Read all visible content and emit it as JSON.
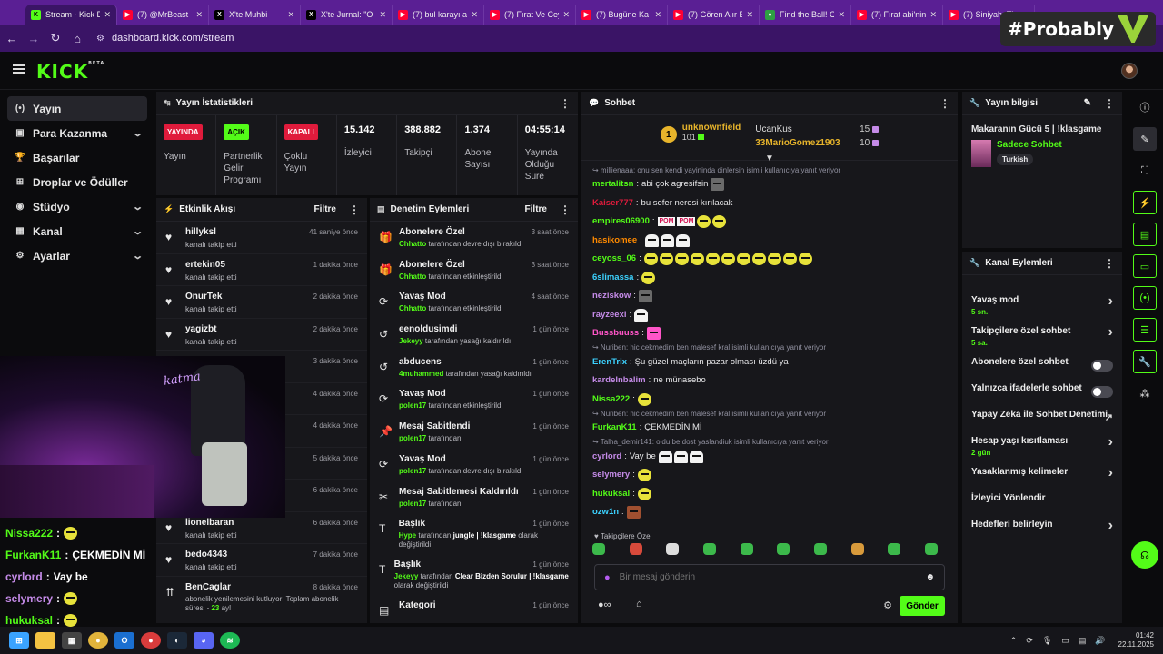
{
  "browser": {
    "tabs": [
      {
        "label": "Stream - Kick D",
        "fav": "kick",
        "favtext": "K",
        "active": true
      },
      {
        "label": "(7) @MrBeast",
        "fav": "yt",
        "favtext": "▶",
        "active": false
      },
      {
        "label": "X'te  Muhbi",
        "fav": "x",
        "favtext": "X",
        "active": false
      },
      {
        "label": "X'te Jurnal: \"O",
        "fav": "x",
        "favtext": "X",
        "active": false
      },
      {
        "label": "(7) bul karayı a",
        "fav": "yt",
        "favtext": "▶",
        "active": false
      },
      {
        "label": "(7) Fırat Ve Ceyl",
        "fav": "yt",
        "favtext": "▶",
        "active": false
      },
      {
        "label": "(7) Bugüne Ka",
        "fav": "yt",
        "favtext": "▶",
        "active": false
      },
      {
        "label": "(7) Gören Alır B",
        "fav": "yt",
        "favtext": "▶",
        "active": false
      },
      {
        "label": "Find the Ball! C",
        "fav": "ball",
        "favtext": "●",
        "active": false
      },
      {
        "label": "(7) Fırat abi'nin",
        "fav": "yt",
        "favtext": "▶",
        "active": false
      },
      {
        "label": "(7) Siniyah: The",
        "fav": "yt",
        "favtext": "▶",
        "active": false
      }
    ],
    "url": "dashboard.kick.com/stream",
    "overlay_tag": "#Probably"
  },
  "kick": {
    "logo": "KICK",
    "logo_sup": "BETA"
  },
  "sidebar": {
    "items": [
      {
        "label": "Yayın",
        "icon": "(•)",
        "chevron": false,
        "active": true
      },
      {
        "label": "Para Kazanma",
        "icon": "▣",
        "chevron": true,
        "active": false
      },
      {
        "label": "Başarılar",
        "icon": "🏆",
        "chevron": false,
        "active": false
      },
      {
        "label": "Droplar ve Ödüller",
        "icon": "⊞",
        "chevron": false,
        "active": false
      },
      {
        "label": "Stüdyo",
        "icon": "◉",
        "chevron": true,
        "active": false
      },
      {
        "label": "Kanal",
        "icon": "▦",
        "chevron": true,
        "active": false
      },
      {
        "label": "Ayarlar",
        "icon": "⚙",
        "chevron": true,
        "active": false
      }
    ]
  },
  "stats": {
    "title": "Yayın İstatistikleri",
    "cells": [
      {
        "badge": "YAYINDA",
        "badge_color": "red",
        "label": "Yayın"
      },
      {
        "badge": "AÇIK",
        "badge_color": "green",
        "label": "Partnerlik Gelir Programı"
      },
      {
        "badge": "KAPALI",
        "badge_color": "red",
        "label": "Çoklu Yayın"
      },
      {
        "value": "15.142",
        "label": "İzleyici"
      },
      {
        "value": "388.882",
        "label": "Takipçi"
      },
      {
        "value": "1.374",
        "label": "Abone Sayısı"
      },
      {
        "value": "04:55:14",
        "label": "Yayında Olduğu Süre"
      }
    ]
  },
  "activity": {
    "title": "Etkinlik Akışı",
    "filter": "Filtre",
    "rows": [
      {
        "name": "hillyksl",
        "sub": "kanalı takip etti",
        "time": "41 saniye önce"
      },
      {
        "name": "ertekin05",
        "sub": "kanalı takip etti",
        "time": "1 dakika önce"
      },
      {
        "name": "OnurTek",
        "sub": "kanalı takip etti",
        "time": "2 dakika önce"
      },
      {
        "name": "yagizbt",
        "sub": "kanalı takip etti",
        "time": "2 dakika önce"
      },
      {
        "name": "",
        "sub": "",
        "time": "3 dakika önce"
      },
      {
        "name": "",
        "sub": "",
        "time": "4 dakika önce"
      },
      {
        "name": "",
        "sub": "",
        "time": "4 dakika önce"
      },
      {
        "name": "",
        "sub": "",
        "time": "5 dakika önce"
      },
      {
        "name": "",
        "sub": "",
        "time": "6 dakika önce"
      },
      {
        "name": "lionelbaran",
        "sub": "kanalı takip etti",
        "time": "6 dakika önce"
      },
      {
        "name": "bedo4343",
        "sub": "kanalı takip etti",
        "time": "7 dakika önce"
      }
    ],
    "last": {
      "name": "BenCaglar",
      "sub_pre": "abonelik yenilemesini kutluyor! Toplam abonelik süresi - ",
      "sub_num": "23",
      "sub_post": " ay!",
      "time": "8 dakika önce"
    }
  },
  "moderation": {
    "title": "Denetim Eylemleri",
    "filter": "Filtre",
    "rows": [
      {
        "icon": "🎁",
        "name": "Abonelere Özel",
        "user": "Chhatto",
        "rest": " tarafından devre dışı bırakıldı",
        "time": "3 saat önce"
      },
      {
        "icon": "🎁",
        "name": "Abonelere Özel",
        "user": "Chhatto",
        "rest": " tarafından etkinleştirildi",
        "time": "3 saat önce"
      },
      {
        "icon": "⟳",
        "name": "Yavaş Mod",
        "user": "Chhatto",
        "rest": " tarafından etkinleştirildi",
        "time": "4 saat önce"
      },
      {
        "icon": "↺",
        "name": "eenoldusimdi",
        "user": "Jekeyy",
        "rest": " tarafından yasağı kaldırıldı",
        "time": "1 gün önce"
      },
      {
        "icon": "↺",
        "name": "abducens",
        "user": "4muhammed",
        "rest": " tarafından yasağı kaldırıldı",
        "time": "1 gün önce"
      },
      {
        "icon": "⟳",
        "name": "Yavaş Mod",
        "user": "polen17",
        "rest": " tarafından etkinleştirildi",
        "time": "1 gün önce"
      },
      {
        "icon": "📌",
        "name": "Mesaj Sabitlendi",
        "user": "polen17",
        "rest": " tarafından",
        "time": "1 gün önce"
      },
      {
        "icon": "⟳",
        "name": "Yavaş Mod",
        "user": "polen17",
        "rest": " tarafından devre dışı bırakıldı",
        "time": "1 gün önce"
      },
      {
        "icon": "✂",
        "name": "Mesaj Sabitlemesi Kaldırıldı",
        "user": "polen17",
        "rest": " tarafından",
        "time": "1 gün önce"
      },
      {
        "icon": "T",
        "name": "Başlık",
        "user": "Hype",
        "rest": " tarafından ",
        "bold": "jungle | !klasgame",
        "rest2": " olarak değiştirildi",
        "time": "1 gün önce"
      },
      {
        "icon": "T",
        "name": "Başlık",
        "user": "Jekeyy",
        "rest": " tarafından ",
        "bold": "Clear Bizden Sorulur | !klasgame",
        "rest2": " olarak değiştirildi",
        "time": "1 gün önce"
      },
      {
        "icon": "▤",
        "name": "Kategori",
        "user": "",
        "rest": "",
        "time": "1 gün önce"
      }
    ]
  },
  "chat": {
    "title": "Sohbet",
    "top": {
      "rank": "1",
      "name": "unknownfield",
      "count": "101"
    },
    "leaders": [
      {
        "name": "UcanKus",
        "count": "15"
      },
      {
        "name": "33MarioGomez1903",
        "count": "10"
      }
    ],
    "messages": [
      {
        "type": "reply",
        "text": "↪ millienaaa: onu sen kendi yayininda dinlersin isimli kullanıcıya yanıt veriyor"
      },
      {
        "type": "msg",
        "user": "mertalitsn",
        "color": "#53fc18",
        "text": "abi çok agresifsin",
        "emotes": [
          "sq"
        ]
      },
      {
        "type": "msg",
        "user": "Kaiser777",
        "color": "#e01b3c",
        "text": "bu sefer neresi kırılacak",
        "emotes": []
      },
      {
        "type": "msg",
        "user": "empires06900",
        "color": "#53fc18",
        "text": "",
        "pom": true,
        "emotes": [
          "y",
          "y"
        ]
      },
      {
        "type": "msg",
        "user": "hasikomee",
        "color": "#ff8a00",
        "text": "",
        "emotes": [
          "wh",
          "wh",
          "wh"
        ]
      },
      {
        "type": "msg",
        "user": "ceyoss_06",
        "color": "#53fc18",
        "text": "",
        "emotes": [
          "y",
          "y",
          "y",
          "y",
          "y",
          "y",
          "y",
          "y",
          "y",
          "y",
          "y"
        ]
      },
      {
        "type": "msg",
        "user": "6slimassa",
        "color": "#3cd2ff",
        "text": "",
        "emotes": [
          "y"
        ]
      },
      {
        "type": "msg",
        "user": "neziskow",
        "color": "#c58be8",
        "text": "",
        "emotes": [
          "sq"
        ]
      },
      {
        "type": "msg",
        "user": "rayzeexi",
        "color": "#c58be8",
        "text": "",
        "emotes": [
          "wh"
        ]
      },
      {
        "type": "msg",
        "user": "Bussbuuss",
        "color": "#ff55c8",
        "text": "",
        "emotes": [
          "pk"
        ]
      },
      {
        "type": "reply",
        "text": "↪ Nuriben: hic cekmedim ben malesef kral isimli kullanıcıya yanıt veriyor"
      },
      {
        "type": "msg",
        "user": "ErenTrix",
        "color": "#3cd2ff",
        "text": "Şu güzel maçların pazar olması üzdü ya",
        "emotes": []
      },
      {
        "type": "msg",
        "user": "kardelnbalim",
        "color": "#c58be8",
        "text": "ne münasebo",
        "emotes": []
      },
      {
        "type": "msg",
        "user": "Nissa222",
        "color": "#53fc18",
        "text": "",
        "emotes": [
          "y"
        ]
      },
      {
        "type": "reply",
        "text": "↪ Nuriben: hic cekmedim ben malesef kral isimli kullanıcıya yanıt veriyor"
      },
      {
        "type": "msg",
        "user": "FurkanK11",
        "color": "#53fc18",
        "text": "ÇEKMEDİN Mİ",
        "emotes": []
      },
      {
        "type": "reply",
        "text": "↪ Talha_demir141: oldu be dost yaslandiuk isimli kullanıcıya yanıt veriyor"
      },
      {
        "type": "msg",
        "user": "cyrlord",
        "color": "#c58be8",
        "text": "Vay be",
        "emotes": [
          "wh",
          "wh",
          "wh"
        ]
      },
      {
        "type": "msg",
        "user": "selymery",
        "color": "#c58be8",
        "text": "",
        "emotes": [
          "y"
        ]
      },
      {
        "type": "msg",
        "user": "hukuksal",
        "color": "#53fc18",
        "text": "",
        "emotes": [
          "y"
        ]
      },
      {
        "type": "msg",
        "user": "ozw1n",
        "color": "#3cd2ff",
        "text": "",
        "emotes": [
          "rd"
        ]
      }
    ],
    "followers_only": "Takipçilere Özel",
    "input_placeholder": "Bir mesaj gönderin",
    "send": "Gönder"
  },
  "stream_info": {
    "title": "Yayın bilgisi",
    "stream_title": "Makaranın Gücü 5 | !klasgame",
    "category": "Sadece Sohbet",
    "tag": "Turkish"
  },
  "channel_actions": {
    "title": "Kanal Eylemleri",
    "items": [
      {
        "label": "Yavaş mod",
        "sub": "5 sn.",
        "end": "chevron"
      },
      {
        "label": "Takipçilere özel sohbet",
        "sub": "5 sa.",
        "end": "chevron"
      },
      {
        "label": "Abonelere özel sohbet",
        "sub": "",
        "end": "toggle"
      },
      {
        "label": "Yalnızca ifadelerle sohbet",
        "sub": "",
        "end": "toggle"
      },
      {
        "label": "Yapay Zeka ile Sohbet Denetimi",
        "sub": "",
        "end": "external"
      },
      {
        "label": "Hesap yaşı kısıtlaması",
        "sub": "2 gün",
        "end": "chevron"
      },
      {
        "label": "Yasaklanmış kelimeler",
        "sub": "",
        "end": "chevron"
      },
      {
        "label": "İzleyici Yönlendir",
        "sub": "",
        "end": ""
      },
      {
        "label": "Hedefleri belirleyin",
        "sub": "",
        "end": "chevron"
      }
    ]
  },
  "video_chat": [
    {
      "user": "Nissa222",
      "color": "#53fc18",
      "text": ""
    },
    {
      "user": "FurkanK11",
      "color": "#53fc18",
      "text": "ÇEKMEDİN Mİ"
    },
    {
      "user": "cyrlord",
      "color": "#c58be8",
      "text": "Vay be"
    },
    {
      "user": "selymery",
      "color": "#c58be8",
      "text": ""
    },
    {
      "user": "hukuksal",
      "color": "#53fc18",
      "text": ""
    }
  ],
  "video_signature": "katma",
  "taskbar": {
    "time": "01:42",
    "date": "22.11.2025"
  }
}
